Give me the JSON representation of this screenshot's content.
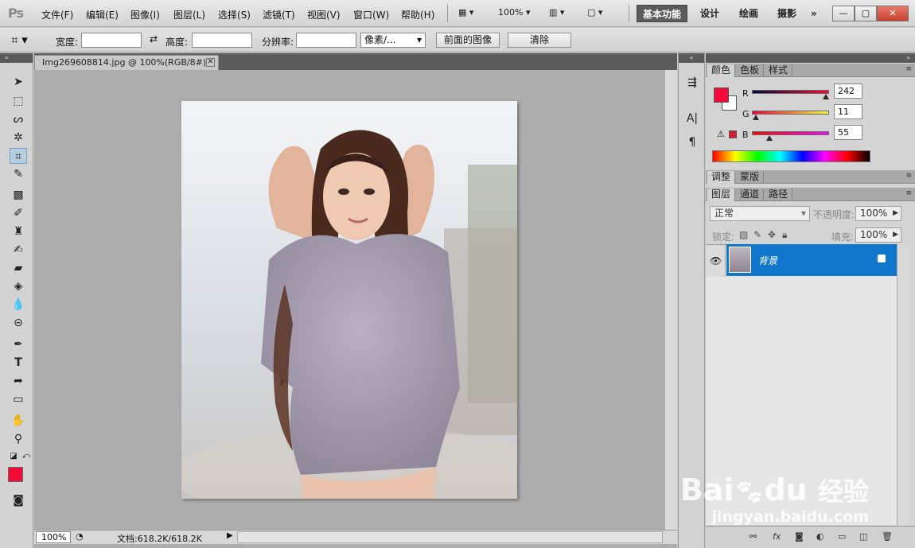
{
  "app": {
    "logo": "Ps"
  },
  "menu": [
    "文件(F)",
    "编辑(E)",
    "图像(I)",
    "图层(L)",
    "选择(S)",
    "滤镜(T)",
    "视图(V)",
    "窗口(W)",
    "帮助(H)"
  ],
  "appbar": {
    "zoom": "100%"
  },
  "workspaces": [
    "基本功能",
    "设计",
    "绘画",
    "摄影"
  ],
  "workspace_more": "»",
  "options": {
    "width_label": "宽度:",
    "height_label": "高度:",
    "resolution_label": "分辨率:",
    "unit_select": "像素/...",
    "front_image_btn": "前面的图像",
    "clear_btn": "清除"
  },
  "document": {
    "tab_title": "Img269608814.jpg @ 100%(RGB/8#)",
    "status_zoom": "100%",
    "status_doc": "文档:618.2K/618.2K"
  },
  "color_panel": {
    "tabs": [
      "颜色",
      "色板",
      "样式"
    ],
    "channels": [
      {
        "label": "R",
        "value": "242",
        "fraction": 0.95
      },
      {
        "label": "G",
        "value": "11",
        "fraction": 0.04
      },
      {
        "label": "B",
        "value": "55",
        "fraction": 0.22
      }
    ],
    "fg_color": "#f20b37",
    "bg_color": "#ffffff"
  },
  "adjust_panel": {
    "tabs": [
      "调整",
      "蒙版"
    ]
  },
  "layers_panel": {
    "tabs": [
      "图层",
      "通道",
      "路径"
    ],
    "blend_mode": "正常",
    "opacity_label": "不透明度:",
    "opacity_value": "100%",
    "lock_label": "锁定:",
    "fill_label": "填充:",
    "fill_value": "100%",
    "layers": [
      {
        "name": "背景"
      }
    ]
  },
  "watermark": {
    "brand": "Bai",
    "brand2": "du",
    "cn": "经验",
    "url": "jingyan.baidu.com"
  }
}
